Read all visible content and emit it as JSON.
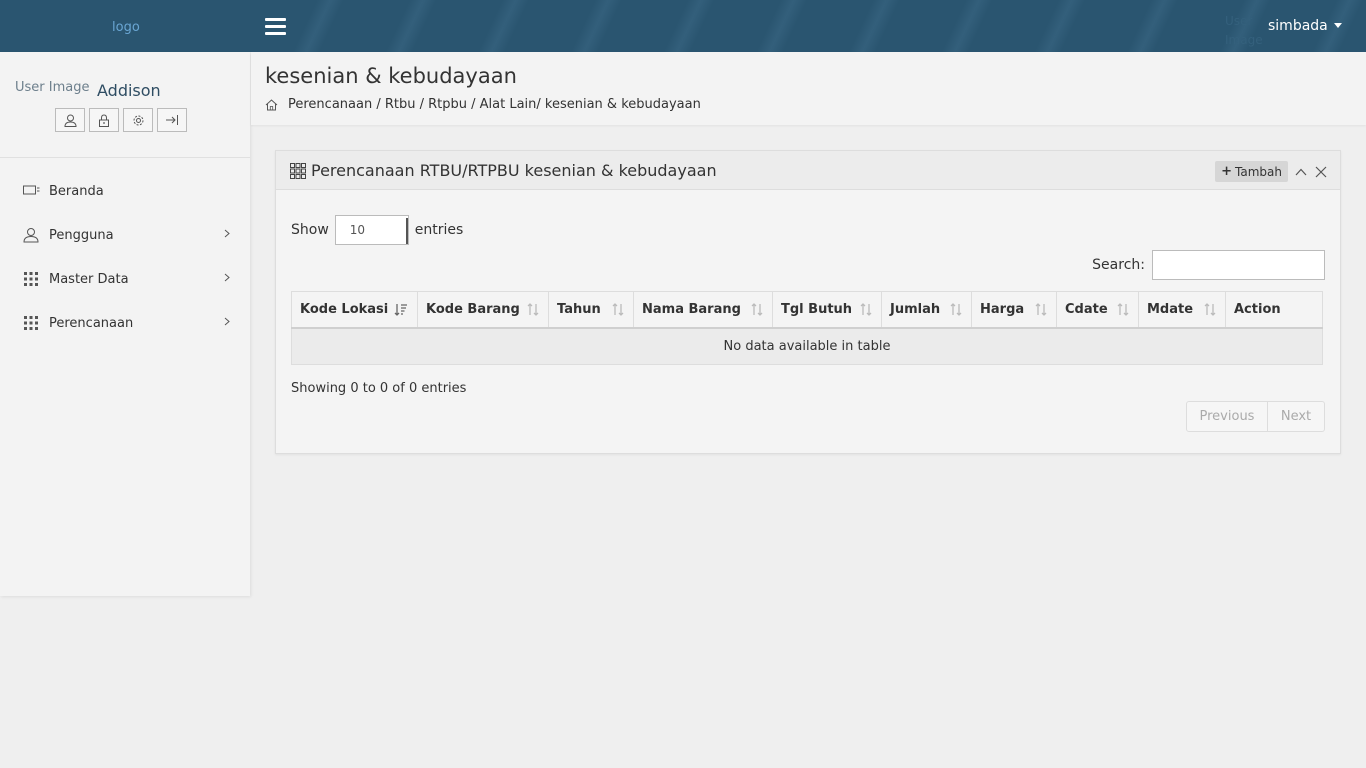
{
  "header": {
    "logo_alt": "logo",
    "user_image_alt": "User Image",
    "user_name": "simbada"
  },
  "sidebar": {
    "profile_image_alt": "User Image",
    "profile_name": "Addison",
    "items": [
      {
        "label": "Beranda",
        "icon": "monitor-icon",
        "has_children": false
      },
      {
        "label": "Pengguna",
        "icon": "user-icon",
        "has_children": true
      },
      {
        "label": "Master Data",
        "icon": "grid-icon",
        "has_children": true
      },
      {
        "label": "Perencanaan",
        "icon": "grid-icon",
        "has_children": true
      }
    ]
  },
  "page": {
    "title": "kesenian & kebudayaan",
    "breadcrumb": "Perencanaan / Rtbu / Rtpbu /  Alat Lain/ kesenian & kebudayaan"
  },
  "panel": {
    "title": "Perencanaan RTBU/RTPBU kesenian & kebudayaan",
    "add_label": "Tambah",
    "show_label": "Show",
    "entries_label": "entries",
    "length_value": "10",
    "search_label": "Search:",
    "search_value": "",
    "columns": [
      "Kode Lokasi",
      "Kode Barang",
      "Tahun",
      "Nama Barang",
      "Tgl Butuh",
      "Jumlah",
      "Harga",
      "Cdate",
      "Mdate",
      "Action"
    ],
    "empty_message": "No data available in table",
    "info": "Showing 0 to 0 of 0 entries",
    "previous_label": "Previous",
    "next_label": "Next"
  },
  "colors": {
    "header_bg": "#2a5570",
    "logo_text": "#6aa6d3",
    "sidebar_bg": "#f3f3f3",
    "page_bg": "#efefef"
  }
}
